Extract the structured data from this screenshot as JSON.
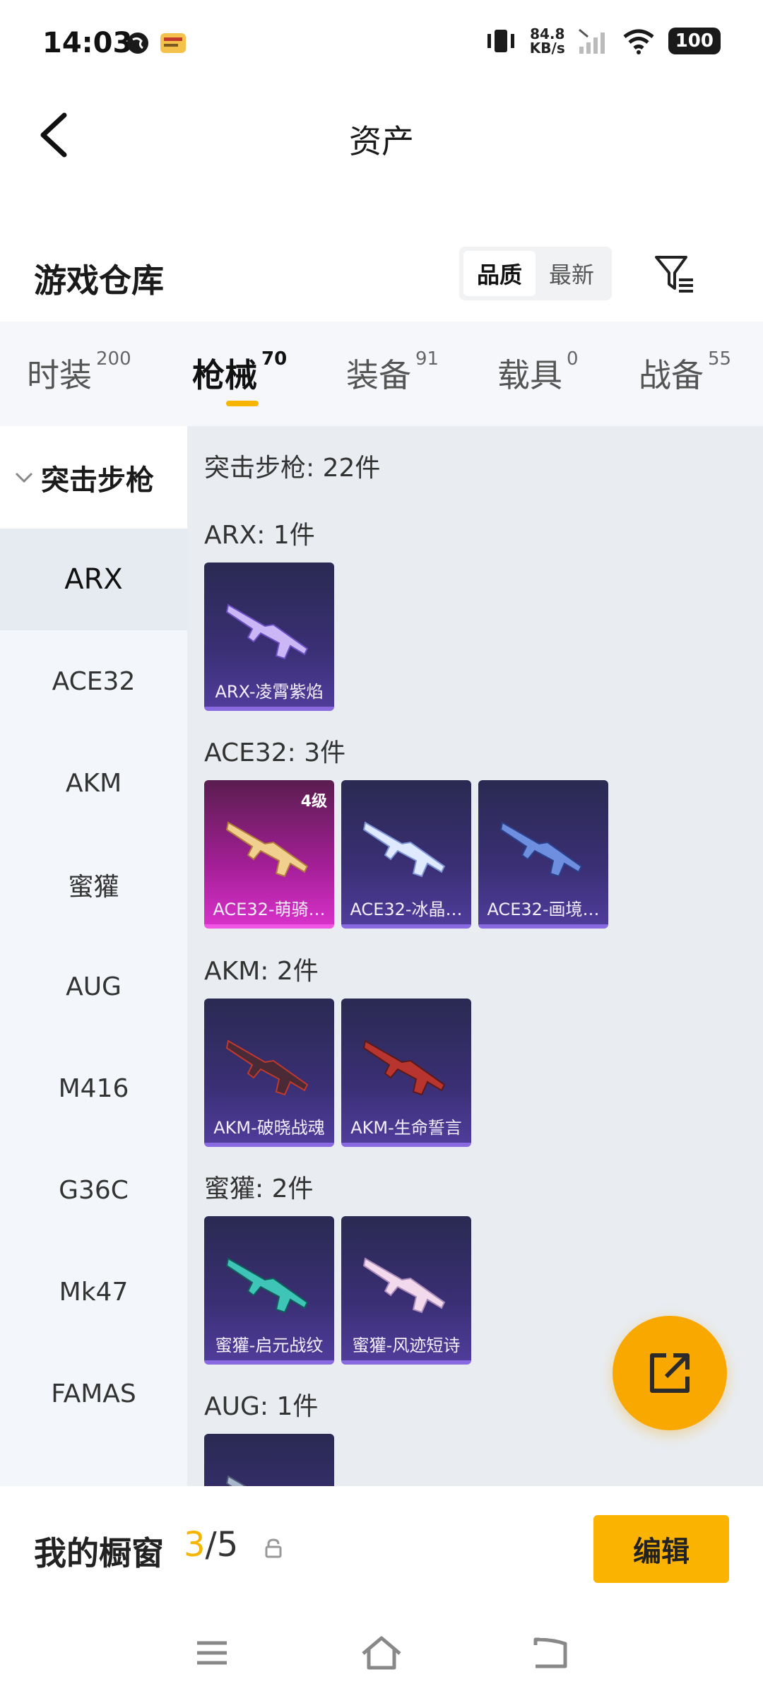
{
  "status": {
    "time": "14:03",
    "net_speed_value": "84.8",
    "net_speed_unit": "KB/s",
    "battery": "100"
  },
  "header": {
    "title": "资产"
  },
  "warehouse": {
    "title": "游戏仓库",
    "sort_options": [
      "品质",
      "最新"
    ]
  },
  "tabs": [
    {
      "label": "时装",
      "count": "200"
    },
    {
      "label": "枪械",
      "count": "70"
    },
    {
      "label": "装备",
      "count": "91"
    },
    {
      "label": "载具",
      "count": "0"
    },
    {
      "label": "战备",
      "count": "55"
    }
  ],
  "sidebar": {
    "group": "突击步枪",
    "items": [
      "ARX",
      "ACE32",
      "AKM",
      "蜜獾",
      "AUG",
      "M416",
      "G36C",
      "Mk47",
      "FAMAS"
    ]
  },
  "content": {
    "category_title": "突击步枪: 22件",
    "sections": [
      {
        "label": "ARX: 1件",
        "cards": [
          {
            "name": "ARX-凌霄紫焰"
          }
        ]
      },
      {
        "label": "ACE32: 3件",
        "cards": [
          {
            "name": "ACE32-萌骑…",
            "level": "4级"
          },
          {
            "name": "ACE32-冰晶…"
          },
          {
            "name": "ACE32-画境…"
          }
        ]
      },
      {
        "label": "AKM: 2件",
        "cards": [
          {
            "name": "AKM-破晓战魂"
          },
          {
            "name": "AKM-生命誓言"
          }
        ]
      },
      {
        "label": "蜜獾: 2件",
        "cards": [
          {
            "name": "蜜獾-启元战纹"
          },
          {
            "name": "蜜獾-风迹短诗"
          }
        ]
      },
      {
        "label": "AUG: 1件",
        "cards": []
      }
    ]
  },
  "showcase": {
    "label": "我的橱窗",
    "current": "3",
    "total": "/5",
    "edit_label": "编辑"
  },
  "colors": {
    "accent": "#f7b500",
    "card_purple": "#3a2f74",
    "card_pink": "#d631c8"
  }
}
